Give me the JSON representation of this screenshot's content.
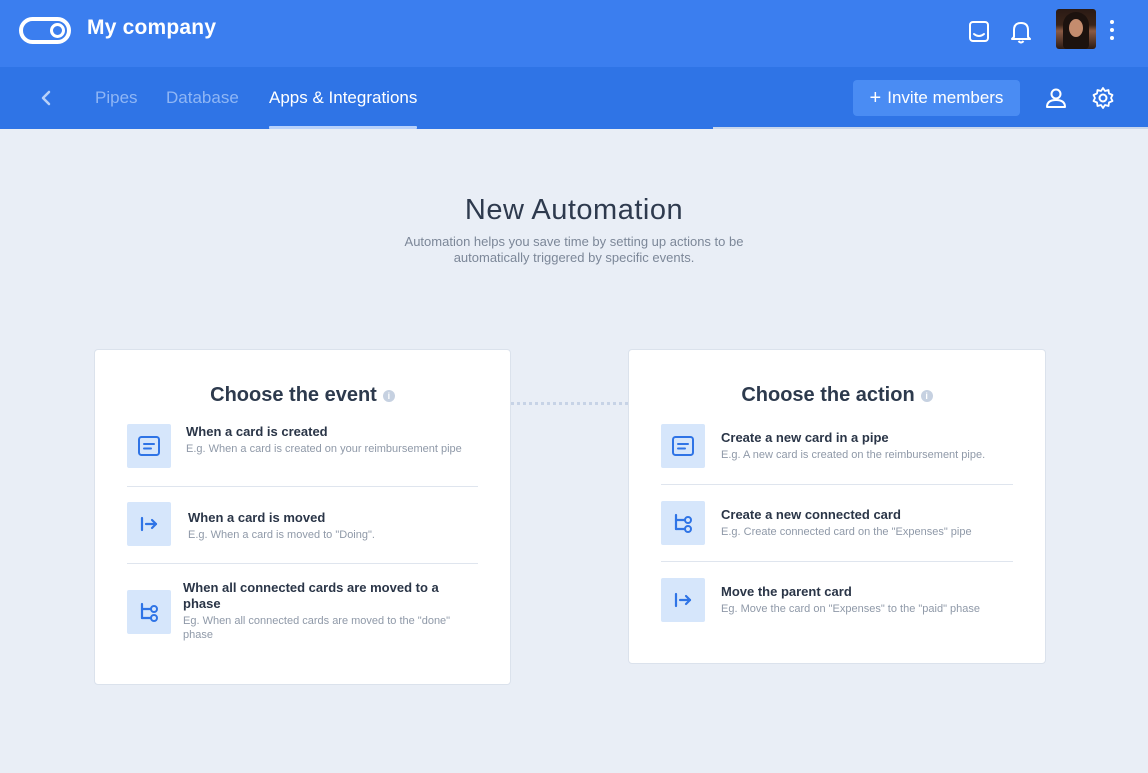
{
  "header": {
    "company_name": "My company",
    "icons": [
      "inbox-icon",
      "bell-icon",
      "avatar",
      "more-vertical-icon"
    ]
  },
  "subnav": {
    "tabs": [
      {
        "label": "Pipes",
        "active": false
      },
      {
        "label": "Database",
        "active": false
      },
      {
        "label": "Apps & Integrations",
        "active": true
      }
    ],
    "invite_label": "Invite members"
  },
  "main": {
    "title": "New Automation",
    "subtitle": "Automation helps you save time by setting up actions to be automatically triggered by specific events."
  },
  "event_panel": {
    "title": "Choose the event",
    "items": [
      {
        "title": "When a card is created",
        "desc": "E.g. When a card is created on your reimbursement pipe",
        "icon": "card-icon"
      },
      {
        "title": "When a card is moved",
        "desc": "E.g. When a card is moved to \"Doing\".",
        "icon": "move-arrow-icon"
      },
      {
        "title": "When all connected cards are moved to a phase",
        "desc": "Eg. When all connected cards are moved to the \"done\" phase",
        "icon": "connected-cards-icon"
      }
    ]
  },
  "action_panel": {
    "title": "Choose the action",
    "items": [
      {
        "title": "Create a new card in a pipe",
        "desc": "E.g. A new card is created on the reimbursement pipe.",
        "icon": "card-icon"
      },
      {
        "title": "Create a new connected card",
        "desc": "E.g. Create connected card on the \"Expenses\" pipe",
        "icon": "connected-cards-icon"
      },
      {
        "title": "Move the parent card",
        "desc": "Eg. Move the card on \"Expenses\" to the \"paid\" phase",
        "icon": "move-arrow-icon"
      }
    ]
  },
  "colors": {
    "topbar": "#3b7eef",
    "subnav": "#2f74e6",
    "background": "#e9eef6",
    "accent": "#3b7eef",
    "icon_tile": "#d6e6fb"
  }
}
